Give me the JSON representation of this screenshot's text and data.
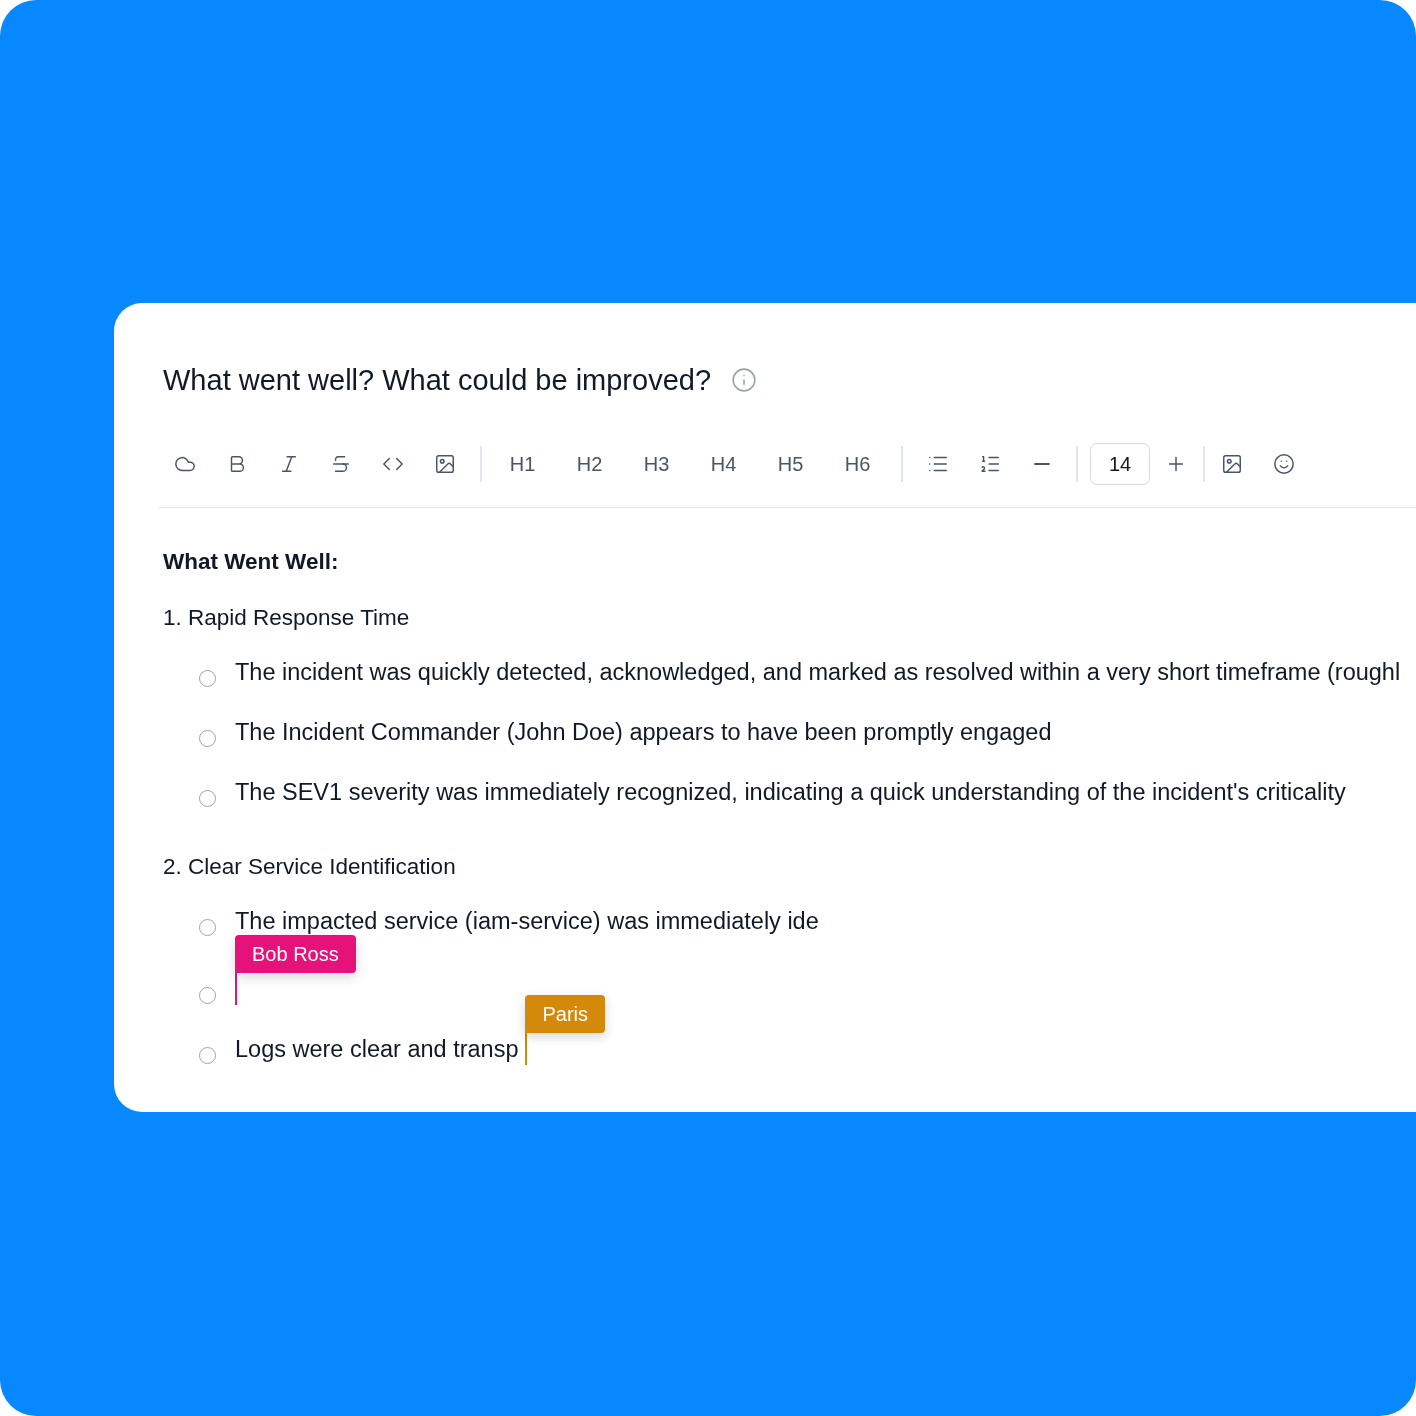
{
  "question": {
    "title": "What went well? What could be improved?"
  },
  "toolbar": {
    "headings": [
      "H1",
      "H2",
      "H3",
      "H4",
      "H5",
      "H6"
    ],
    "font_size": "14"
  },
  "document": {
    "heading": "What Went Well:",
    "sections": [
      {
        "title": "1. Rapid Response Time",
        "items": [
          {
            "text": "The incident was quickly detected, acknowledged, and marked as resolved within a very short timeframe (roughl"
          },
          {
            "text": "The Incident Commander (John Doe) appears to have been promptly engaged"
          },
          {
            "text": "The SEV1 severity was immediately recognized, indicating a quick understanding of the incident's criticality"
          }
        ]
      },
      {
        "title": "2. Clear Service Identification",
        "items": [
          {
            "text": "The impacted service (iam-service) was immediately ide"
          },
          {
            "cursor": {
              "name": "Bob Ross",
              "color": "#e5127a"
            }
          },
          {
            "text": "Logs were clear and transp",
            "cursor": {
              "name": "Paris",
              "color": "#d4890a"
            }
          }
        ]
      }
    ]
  }
}
